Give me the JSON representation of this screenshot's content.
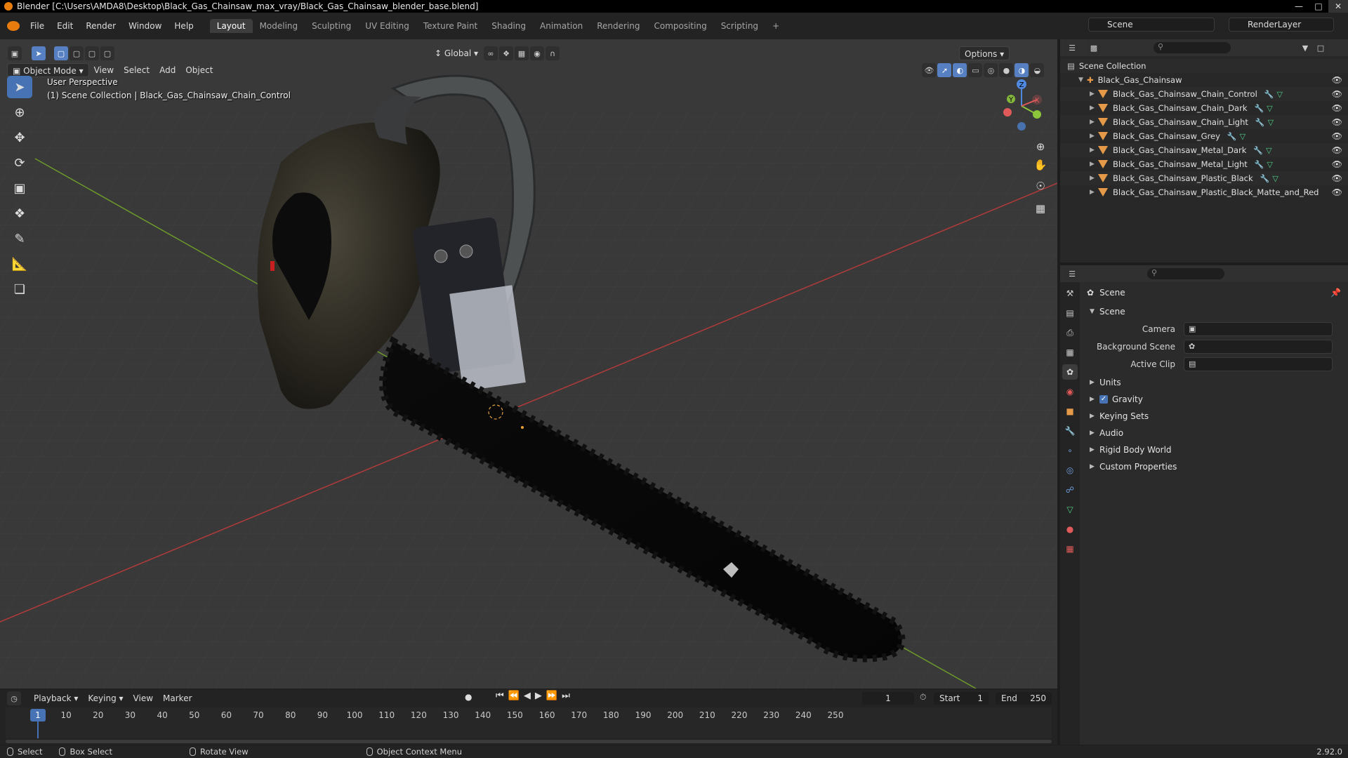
{
  "title_bar": {
    "text": "Blender [C:\\Users\\AMDA8\\Desktop\\Black_Gas_Chainsaw_max_vray/Black_Gas_Chainsaw_blender_base.blend]"
  },
  "menu": [
    "File",
    "Edit",
    "Render",
    "Window",
    "Help"
  ],
  "workspaces": [
    "Layout",
    "Modeling",
    "Sculpting",
    "UV Editing",
    "Texture Paint",
    "Shading",
    "Animation",
    "Rendering",
    "Compositing",
    "Scripting"
  ],
  "workspace_add": "+",
  "scene_name": "Scene",
  "view_layer": "RenderLayer",
  "viewport": {
    "transform_orientation": "Global",
    "options_label": "Options",
    "mode": "Object Mode",
    "header_menus": [
      "View",
      "Select",
      "Add",
      "Object"
    ],
    "info_line1": "User Perspective",
    "info_line2": "(1) Scene Collection | Black_Gas_Chainsaw_Chain_Control",
    "gizmo_axes": {
      "x": "X",
      "y": "Y",
      "z": "Z"
    }
  },
  "outliner": {
    "root": "Scene Collection",
    "collection": "Black_Gas_Chainsaw",
    "objects": [
      "Black_Gas_Chainsaw_Chain_Control",
      "Black_Gas_Chainsaw_Chain_Dark",
      "Black_Gas_Chainsaw_Chain_Light",
      "Black_Gas_Chainsaw_Grey",
      "Black_Gas_Chainsaw_Metal_Dark",
      "Black_Gas_Chainsaw_Metal_Light",
      "Black_Gas_Chainsaw_Plastic_Black",
      "Black_Gas_Chainsaw_Plastic_Black_Matte_and_Red"
    ]
  },
  "properties": {
    "context": "Scene",
    "panel": "Scene",
    "camera_label": "Camera",
    "background_scene_label": "Background Scene",
    "active_clip_label": "Active Clip",
    "sections": [
      "Units",
      "Gravity",
      "Keying Sets",
      "Audio",
      "Rigid Body World",
      "Custom Properties"
    ],
    "gravity_checked": true
  },
  "timeline": {
    "menus": [
      "Playback",
      "Keying",
      "View",
      "Marker"
    ],
    "current_frame": "1",
    "start_label": "Start",
    "start": "1",
    "end_label": "End",
    "end": "250",
    "ticks": [
      "10",
      "20",
      "30",
      "40",
      "50",
      "60",
      "70",
      "80",
      "90",
      "100",
      "110",
      "120",
      "130",
      "140",
      "150",
      "160",
      "170",
      "180",
      "190",
      "200",
      "210",
      "220",
      "230",
      "240",
      "250"
    ]
  },
  "statusbar": {
    "select": "Select",
    "box_select": "Box Select",
    "rotate_view": "Rotate View",
    "context_menu": "Object Context Menu",
    "version": "2.92.0"
  },
  "colors": {
    "accent": "#4772b3",
    "x_axis": "#e05a5a",
    "y_axis": "#8cc43c",
    "z_axis": "#4f8ae0",
    "mesh_icon": "#e59a4a"
  }
}
